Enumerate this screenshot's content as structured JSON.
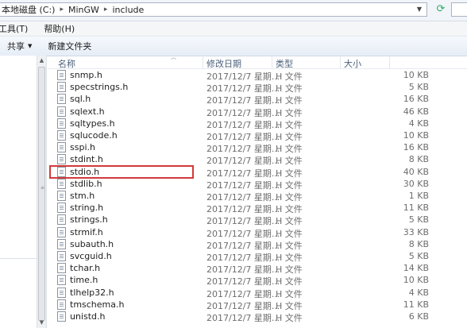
{
  "address": {
    "crumbs": [
      "本地磁盘 (C:)",
      "MinGW",
      "include"
    ],
    "separator": "▸",
    "refresh_icon": "refresh-icon"
  },
  "menu": {
    "items": [
      "工具(T)",
      "帮助(H)"
    ]
  },
  "toolbar": {
    "share_label": "共享",
    "new_folder_label": "新建文件夹"
  },
  "columns": {
    "name": "名称",
    "date": "修改日期",
    "type": "类型",
    "size": "大小"
  },
  "files": [
    {
      "name": "snmp.h",
      "date": "2017/12/7 星期...",
      "type": "H 文件",
      "size": "10 KB"
    },
    {
      "name": "specstrings.h",
      "date": "2017/12/7 星期...",
      "type": "H 文件",
      "size": "5 KB"
    },
    {
      "name": "sql.h",
      "date": "2017/12/7 星期...",
      "type": "H 文件",
      "size": "16 KB"
    },
    {
      "name": "sqlext.h",
      "date": "2017/12/7 星期...",
      "type": "H 文件",
      "size": "46 KB"
    },
    {
      "name": "sqltypes.h",
      "date": "2017/12/7 星期...",
      "type": "H 文件",
      "size": "4 KB"
    },
    {
      "name": "sqlucode.h",
      "date": "2017/12/7 星期...",
      "type": "H 文件",
      "size": "10 KB"
    },
    {
      "name": "sspi.h",
      "date": "2017/12/7 星期...",
      "type": "H 文件",
      "size": "16 KB"
    },
    {
      "name": "stdint.h",
      "date": "2017/12/7 星期...",
      "type": "H 文件",
      "size": "8 KB"
    },
    {
      "name": "stdio.h",
      "date": "2017/12/7 星期...",
      "type": "H 文件",
      "size": "40 KB"
    },
    {
      "name": "stdlib.h",
      "date": "2017/12/7 星期...",
      "type": "H 文件",
      "size": "30 KB"
    },
    {
      "name": "stm.h",
      "date": "2017/12/7 星期...",
      "type": "H 文件",
      "size": "1 KB"
    },
    {
      "name": "string.h",
      "date": "2017/12/7 星期...",
      "type": "H 文件",
      "size": "11 KB"
    },
    {
      "name": "strings.h",
      "date": "2017/12/7 星期...",
      "type": "H 文件",
      "size": "5 KB"
    },
    {
      "name": "strmif.h",
      "date": "2017/12/7 星期...",
      "type": "H 文件",
      "size": "33 KB"
    },
    {
      "name": "subauth.h",
      "date": "2017/12/7 星期...",
      "type": "H 文件",
      "size": "8 KB"
    },
    {
      "name": "svcguid.h",
      "date": "2017/12/7 星期...",
      "type": "H 文件",
      "size": "5 KB"
    },
    {
      "name": "tchar.h",
      "date": "2017/12/7 星期...",
      "type": "H 文件",
      "size": "14 KB"
    },
    {
      "name": "time.h",
      "date": "2017/12/7 星期...",
      "type": "H 文件",
      "size": "10 KB"
    },
    {
      "name": "tlhelp32.h",
      "date": "2017/12/7 星期...",
      "type": "H 文件",
      "size": "4 KB"
    },
    {
      "name": "tmschema.h",
      "date": "2017/12/7 星期...",
      "type": "H 文件",
      "size": "11 KB"
    },
    {
      "name": "unistd.h",
      "date": "2017/12/7 星期...",
      "type": "H 文件",
      "size": "6 KB"
    }
  ],
  "highlighted_file": "stdio.h",
  "colors": {
    "highlight_border": "#d23a3a",
    "header_text": "#4c607a"
  }
}
